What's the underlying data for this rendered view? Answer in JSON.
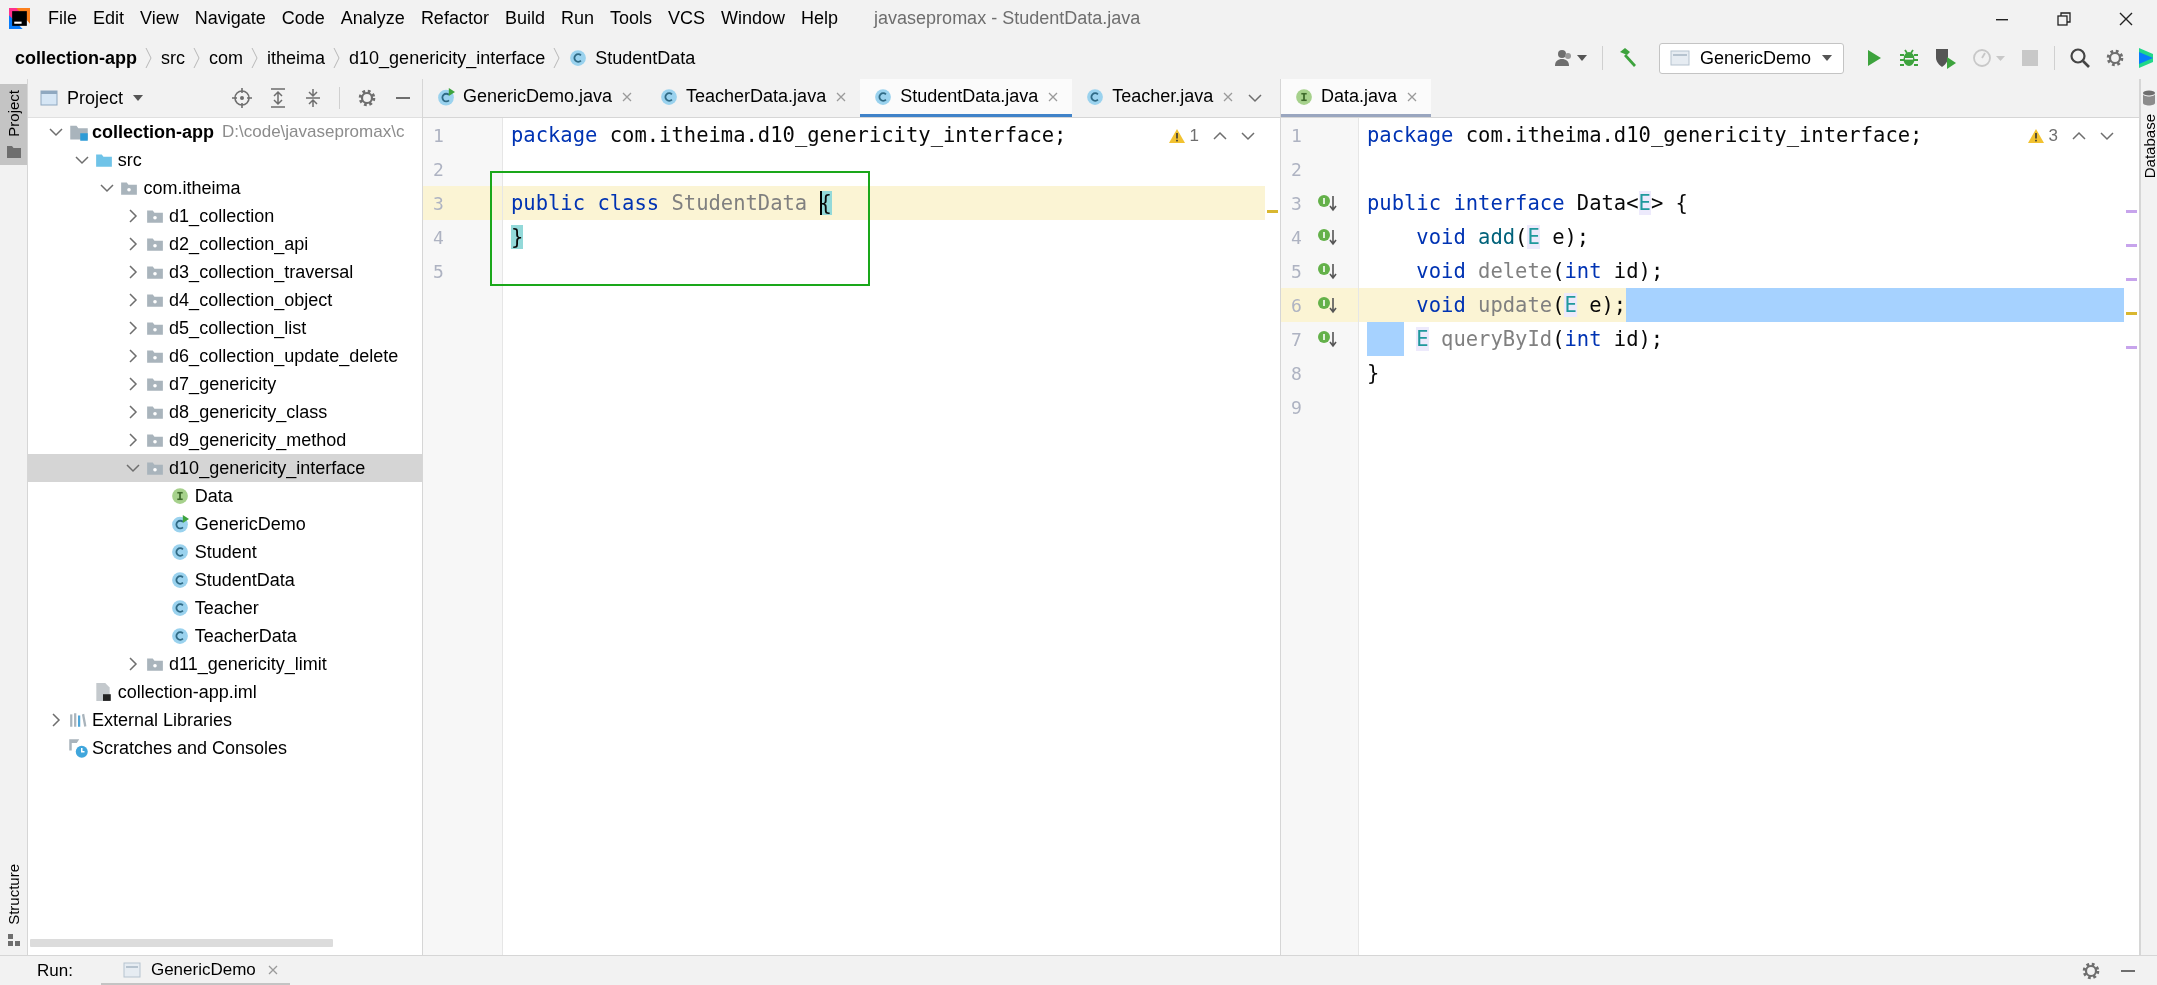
{
  "window": {
    "title": "javasepromax - StudentData.java"
  },
  "menu": [
    "File",
    "Edit",
    "View",
    "Navigate",
    "Code",
    "Analyze",
    "Refactor",
    "Build",
    "Run",
    "Tools",
    "VCS",
    "Window",
    "Help"
  ],
  "breadcrumbs": [
    {
      "label": "collection-app",
      "kind": "module"
    },
    {
      "label": "src",
      "kind": "folder"
    },
    {
      "label": "com",
      "kind": "folder"
    },
    {
      "label": "itheima",
      "kind": "folder"
    },
    {
      "label": "d10_genericity_interface",
      "kind": "folder"
    },
    {
      "label": "StudentData",
      "kind": "class"
    }
  ],
  "toolbar": {
    "run_configuration": "GenericDemo",
    "buttons": [
      {
        "kind": "run",
        "disabled": false
      },
      {
        "kind": "debug",
        "disabled": false
      },
      {
        "kind": "coverage",
        "disabled": false
      },
      {
        "kind": "profile",
        "disabled": true
      },
      {
        "kind": "stop",
        "disabled": true
      }
    ]
  },
  "tool_stripes": {
    "left_top": [
      {
        "label": "Project",
        "kind": "project",
        "selected": true
      }
    ],
    "left_bottom": [
      {
        "label": "Structure",
        "kind": "structure",
        "selected": false
      }
    ],
    "right": [
      {
        "label": "Database",
        "kind": "database",
        "selected": false
      }
    ]
  },
  "project_panel": {
    "title": "Project",
    "tree": [
      {
        "label": "collection-app",
        "kind": "module",
        "hint": "D:\\code\\javasepromax\\c",
        "expanded": true,
        "selected": false,
        "children": [
          {
            "label": "src",
            "kind": "source_folder",
            "expanded": true,
            "selected": false,
            "children": [
              {
                "label": "com.itheima",
                "kind": "package",
                "expanded": true,
                "selected": false,
                "children": [
                  {
                    "label": "d1_collection",
                    "kind": "package",
                    "expanded": false,
                    "selected": false
                  },
                  {
                    "label": "d2_collection_api",
                    "kind": "package",
                    "expanded": false,
                    "selected": false
                  },
                  {
                    "label": "d3_collection_traversal",
                    "kind": "package",
                    "expanded": false,
                    "selected": false
                  },
                  {
                    "label": "d4_collection_object",
                    "kind": "package",
                    "expanded": false,
                    "selected": false
                  },
                  {
                    "label": "d5_collection_list",
                    "kind": "package",
                    "expanded": false,
                    "selected": false
                  },
                  {
                    "label": "d6_collection_update_delete",
                    "kind": "package",
                    "expanded": false,
                    "selected": false
                  },
                  {
                    "label": "d7_genericity",
                    "kind": "package",
                    "expanded": false,
                    "selected": false
                  },
                  {
                    "label": "d8_genericity_class",
                    "kind": "package",
                    "expanded": false,
                    "selected": false
                  },
                  {
                    "label": "d9_genericity_method",
                    "kind": "package",
                    "expanded": false,
                    "selected": false
                  },
                  {
                    "label": "d10_genericity_interface",
                    "kind": "package",
                    "expanded": true,
                    "selected": true,
                    "children": [
                      {
                        "label": "Data",
                        "kind": "interface",
                        "selected": false
                      },
                      {
                        "label": "GenericDemo",
                        "kind": "class_runnable",
                        "selected": false
                      },
                      {
                        "label": "Student",
                        "kind": "class",
                        "selected": false
                      },
                      {
                        "label": "StudentData",
                        "kind": "class",
                        "selected": false
                      },
                      {
                        "label": "Teacher",
                        "kind": "class",
                        "selected": false
                      },
                      {
                        "label": "TeacherData",
                        "kind": "class",
                        "selected": false
                      }
                    ]
                  },
                  {
                    "label": "d11_genericity_limit",
                    "kind": "package",
                    "expanded": false,
                    "selected": false
                  }
                ]
              }
            ]
          },
          {
            "label": "collection-app.iml",
            "kind": "iml",
            "selected": false
          }
        ]
      },
      {
        "label": "External Libraries",
        "kind": "libraries",
        "expanded": false,
        "selected": false
      },
      {
        "label": "Scratches and Consoles",
        "kind": "scratches",
        "selected": false
      }
    ]
  },
  "editors": [
    {
      "focused": true,
      "warnings": "1",
      "tabs": [
        {
          "label": "GenericDemo.java",
          "kind": "class_runnable",
          "selected": false
        },
        {
          "label": "TeacherData.java",
          "kind": "class",
          "selected": false
        },
        {
          "label": "StudentData.java",
          "kind": "class",
          "selected": true
        },
        {
          "label": "Teacher.java",
          "kind": "class",
          "selected": false
        }
      ],
      "lines": [
        {
          "number": "1",
          "current": false,
          "tokens": [
            {
              "text": "package",
              "kind": "keyword"
            },
            {
              "text": " com.itheima.d10_genericity_interface;",
              "kind": "plain"
            }
          ]
        },
        {
          "number": "2",
          "current": false
        },
        {
          "number": "3",
          "current": true,
          "tokens": [
            {
              "text": "public class",
              "kind": "keyword"
            },
            {
              "text": " StudentData ",
              "kind": "unused"
            },
            {
              "text": "{",
              "kind": "brace_match",
              "caret": true
            }
          ]
        },
        {
          "number": "4",
          "current": false,
          "tokens": [
            {
              "text": "}",
              "kind": "brace_match"
            }
          ]
        },
        {
          "number": "5",
          "current": false
        }
      ]
    },
    {
      "focused": false,
      "warnings": "3",
      "tabs": [
        {
          "label": "Data.java",
          "kind": "interface",
          "selected": true
        }
      ],
      "lines": [
        {
          "number": "1",
          "current": false,
          "implemented": false,
          "selected_to_end": false,
          "indent_selected": false,
          "tokens": [
            {
              "text": "package",
              "kind": "keyword"
            },
            {
              "text": " com.itheima.d10_genericity_interface;",
              "kind": "plain"
            }
          ]
        },
        {
          "number": "2",
          "current": false,
          "implemented": false,
          "selected_to_end": false,
          "indent_selected": false
        },
        {
          "number": "3",
          "current": false,
          "implemented": true,
          "selected_to_end": false,
          "indent_selected": false,
          "tokens": [
            {
              "text": "public interface",
              "kind": "keyword"
            },
            {
              "text": " Data<",
              "kind": "plain"
            },
            {
              "text": "E",
              "kind": "type_param"
            },
            {
              "text": "> {",
              "kind": "plain"
            }
          ]
        },
        {
          "number": "4",
          "current": false,
          "implemented": true,
          "selected_to_end": false,
          "indent_selected": false,
          "indented": true,
          "tokens": [
            {
              "text": "void",
              "kind": "keyword"
            },
            {
              "text": " add",
              "kind": "method"
            },
            {
              "text": "(",
              "kind": "plain"
            },
            {
              "text": "E",
              "kind": "type_param"
            },
            {
              "text": " e);",
              "kind": "plain"
            }
          ]
        },
        {
          "number": "5",
          "current": false,
          "implemented": true,
          "selected_to_end": false,
          "indent_selected": false,
          "indented": true,
          "tokens": [
            {
              "text": "void",
              "kind": "keyword"
            },
            {
              "text": " delete",
              "kind": "unused"
            },
            {
              "text": "(",
              "kind": "plain"
            },
            {
              "text": "int",
              "kind": "keyword"
            },
            {
              "text": " id);",
              "kind": "plain"
            }
          ]
        },
        {
          "number": "6",
          "current": true,
          "implemented": true,
          "selected_to_end": true,
          "indent_selected": false,
          "indented": true,
          "tokens": [
            {
              "text": "void",
              "kind": "keyword"
            },
            {
              "text": " update",
              "kind": "unused"
            },
            {
              "text": "(",
              "kind": "plain"
            },
            {
              "text": "E",
              "kind": "type_param"
            },
            {
              "text": " e);",
              "kind": "plain"
            }
          ]
        },
        {
          "number": "7",
          "current": false,
          "implemented": true,
          "selected_to_end": false,
          "indent_selected": true,
          "indented": true,
          "tokens": [
            {
              "text": "E",
              "kind": "type_param"
            },
            {
              "text": " queryById",
              "kind": "unused"
            },
            {
              "text": "(",
              "kind": "plain"
            },
            {
              "text": "int",
              "kind": "keyword"
            },
            {
              "text": " id);",
              "kind": "plain"
            }
          ]
        },
        {
          "number": "8",
          "current": false,
          "implemented": false,
          "selected_to_end": false,
          "indent_selected": false,
          "tokens": [
            {
              "text": "}",
              "kind": "plain"
            }
          ]
        },
        {
          "number": "9",
          "current": false,
          "implemented": false,
          "selected_to_end": false,
          "indent_selected": false
        }
      ]
    }
  ],
  "run_bar": {
    "label": "Run:",
    "tabs": [
      {
        "label": "GenericDemo",
        "selected": true
      }
    ]
  }
}
